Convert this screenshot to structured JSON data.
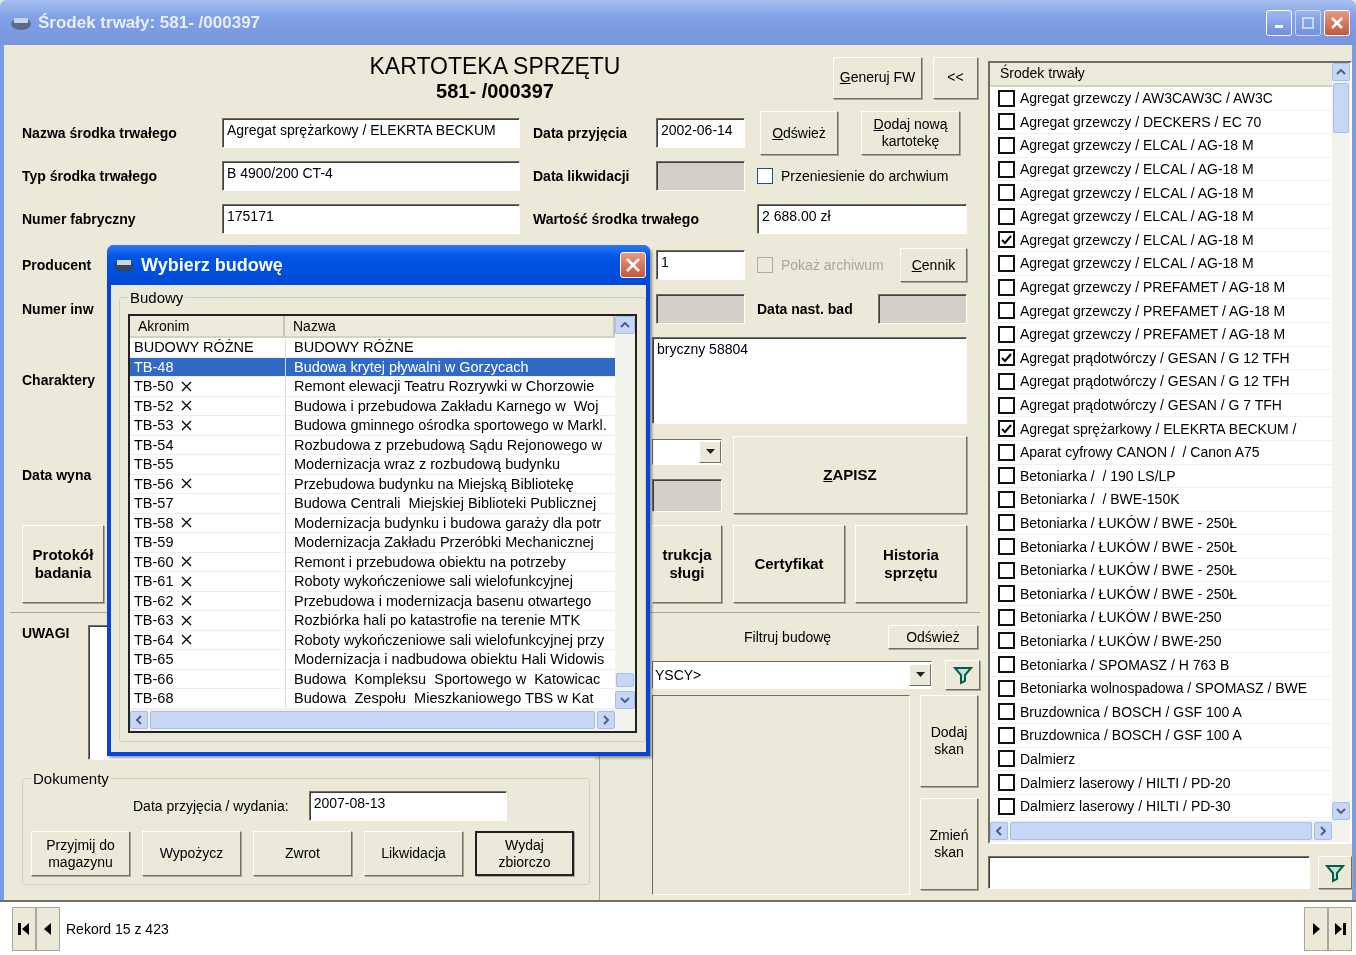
{
  "window": {
    "title": "Środek trwały: 581- /000397"
  },
  "header": {
    "title": "KARTOTEKA SPRZĘTU",
    "number": "581- /000397",
    "buttons": [
      {
        "label": "Generuj FW",
        "mnemonic": true
      },
      {
        "label": "<<",
        "mnemonic": false
      }
    ]
  },
  "form": {
    "name": {
      "label": "Nazwa środka trwałego",
      "value": "Agregat sprężarkowy / ELEKRTA BECKUM"
    },
    "type": {
      "label": "Typ środka trwałego",
      "value": "B 4900/200 CT-4"
    },
    "serial": {
      "label": "Numer fabryczny",
      "value": "175171"
    },
    "producer": {
      "label": "Producent"
    },
    "inventory": {
      "label": "Numer inw"
    },
    "description": {
      "label": "Charaktery",
      "value": "bryczny 58804"
    },
    "issue_date": {
      "label": "Data wyna"
    },
    "received": {
      "label": "Data przyjęcia",
      "value": "2002-06-14"
    },
    "liquidation": {
      "label": "Data likwidacji",
      "disabled": true
    },
    "asset_value": {
      "label": "Wartość środka trwałego",
      "value": "2 688.00 zł"
    },
    "quantity": {
      "value": "1"
    },
    "field_under_quantity": {
      "disabled": true
    },
    "field_under_combo": {
      "disabled": true
    },
    "next_test": {
      "label": "Data nast. bad",
      "disabled": true
    },
    "archive_move": {
      "label": "Przeniesienie do archwium",
      "checked": false,
      "disabled": false
    },
    "show_archive": {
      "label": "Pokaż archiwum",
      "checked": false,
      "disabled": true
    }
  },
  "buttons": {
    "refresh": {
      "label": "Odśwież",
      "mnemonic": true
    },
    "add": {
      "label": "Dodaj nową\nkartotekę",
      "mnemonic": true
    },
    "price": {
      "label": "Cennik",
      "mnemonic": true
    },
    "save": {
      "label": "ZAPISZ",
      "mnemonic": true
    },
    "protocol": {
      "label": "Protokół\nbadania",
      "mnemonic": false
    },
    "manual": {
      "label": "trukcja\nsługi",
      "mnemonic": false
    },
    "certificate": {
      "label": "Certyfikat",
      "mnemonic": false
    },
    "history": {
      "label": "Historia\nsprzętu",
      "mnemonic": false
    }
  },
  "notes": {
    "label": "UWAGI"
  },
  "documents": {
    "title": "Dokumenty",
    "date_label": "Data przyjęcia / wydania:",
    "date_value": "2007-08-13",
    "buttons": [
      {
        "label": "Przyjmij do\nmagazynu",
        "default": false
      },
      {
        "label": "Wypożycz",
        "default": false
      },
      {
        "label": "Zwrot",
        "default": false
      },
      {
        "label": "Likwidacja",
        "default": false
      },
      {
        "label": "Wydaj\nzbiorczo",
        "default": true
      }
    ]
  },
  "site_filter": {
    "label": "Filtruj budowę",
    "refresh": {
      "label": "Odśwież",
      "mnemonic": false
    },
    "value": "YSCY>",
    "scan_buttons": [
      {
        "label": "Dodaj\nskan",
        "mnemonic": false
      },
      {
        "label": "Zmień\nskan",
        "mnemonic": false
      }
    ]
  },
  "assets": {
    "header": "Środek trwały",
    "items": [
      {
        "label": "Agregat grzewczy / AW3CAW3C / AW3C",
        "checked": false
      },
      {
        "label": "Agregat grzewczy / DECKERS / EC 70",
        "checked": false
      },
      {
        "label": "Agregat grzewczy / ELCAL / AG-18 M",
        "checked": false
      },
      {
        "label": "Agregat grzewczy / ELCAL / AG-18 M",
        "checked": false
      },
      {
        "label": "Agregat grzewczy / ELCAL / AG-18 M",
        "checked": false
      },
      {
        "label": "Agregat grzewczy / ELCAL / AG-18 M",
        "checked": false
      },
      {
        "label": "Agregat grzewczy / ELCAL / AG-18 M",
        "checked": true
      },
      {
        "label": "Agregat grzewczy / ELCAL / AG-18 M",
        "checked": false
      },
      {
        "label": "Agregat grzewczy / PREFAMET / AG-18 M",
        "checked": false
      },
      {
        "label": "Agregat grzewczy / PREFAMET / AG-18 M",
        "checked": false
      },
      {
        "label": "Agregat grzewczy / PREFAMET / AG-18 M",
        "checked": false
      },
      {
        "label": "Agregat prądotwórczy / GESAN / G 12 TFH",
        "checked": true
      },
      {
        "label": "Agregat prądotwórczy / GESAN / G 12 TFH",
        "checked": false
      },
      {
        "label": "Agregat prądotwórczy / GESAN / G 7 TFH",
        "checked": false
      },
      {
        "label": "Agregat sprężarkowy / ELEKRTA BECKUM /",
        "checked": true
      },
      {
        "label": "Aparat cyfrowy CANON /  / Canon A75",
        "checked": false
      },
      {
        "label": "Betoniarka /  / 190 LS/LP",
        "checked": false
      },
      {
        "label": "Betoniarka /  / BWE-150K",
        "checked": false
      },
      {
        "label": "Betoniarka / ŁUKÓW / BWE - 250Ł",
        "checked": false
      },
      {
        "label": "Betoniarka / ŁUKÓW / BWE - 250Ł",
        "checked": false
      },
      {
        "label": "Betoniarka / ŁUKÓW / BWE - 250Ł",
        "checked": false
      },
      {
        "label": "Betoniarka / ŁUKÓW / BWE - 250Ł",
        "checked": false
      },
      {
        "label": "Betoniarka / ŁUKÓW / BWE-250",
        "checked": false
      },
      {
        "label": "Betoniarka / ŁUKÓW / BWE-250",
        "checked": false
      },
      {
        "label": "Betoniarka / SPOMASZ / H 763 B",
        "checked": false
      },
      {
        "label": "Betoniarka wolnospadowa / SPOMASZ / BWE",
        "checked": false
      },
      {
        "label": "Bruzdownica / BOSCH / GSF 100 A",
        "checked": false
      },
      {
        "label": "Bruzdownica / BOSCH / GSF 100 A",
        "checked": false
      },
      {
        "label": "Dalmierz",
        "checked": false
      },
      {
        "label": "Dalmierz laserowy / HILTI / PD-20",
        "checked": false
      },
      {
        "label": "Dalmierz laserowy / HILTI / PD-30",
        "checked": false
      }
    ]
  },
  "record": {
    "text": "Rekord 15 z 423"
  },
  "dialog": {
    "title": "Wybierz budowę",
    "group": "Budowy",
    "columns": [
      "Akronim",
      "Nazwa"
    ],
    "rows": [
      {
        "acronym": "BUDOWY RÓŻNE",
        "name": "BUDOWY RÓŻNE",
        "crossed": false,
        "selected": false
      },
      {
        "acronym": "TB-48",
        "name": "Budowa krytej pływalni w Gorzycach",
        "crossed": false,
        "selected": true
      },
      {
        "acronym": "TB-50",
        "name": "Remont elewacji Teatru Rozrywki w Chorzowie",
        "crossed": true,
        "selected": false
      },
      {
        "acronym": "TB-52",
        "name": "Budowa i przebudowa Zakładu Karnego w  Woj",
        "crossed": true,
        "selected": false
      },
      {
        "acronym": "TB-53",
        "name": "Budowa gminnego ośrodka sportowego w Markl.",
        "crossed": true,
        "selected": false
      },
      {
        "acronym": "TB-54",
        "name": "Rozbudowa z przebudową Sądu Rejonowego w",
        "crossed": false,
        "selected": false
      },
      {
        "acronym": "TB-55",
        "name": "Modernizacja wraz z rozbudową budynku",
        "crossed": false,
        "selected": false
      },
      {
        "acronym": "TB-56",
        "name": "Przebudowa budynku na Miejską Bibliotekę",
        "crossed": true,
        "selected": false
      },
      {
        "acronym": "TB-57",
        "name": "Budowa Centrali  Miejskiej Biblioteki Publicznej",
        "crossed": false,
        "selected": false
      },
      {
        "acronym": "TB-58",
        "name": "Modernizacja budynku i budowa garaży dla potr",
        "crossed": true,
        "selected": false
      },
      {
        "acronym": "TB-59",
        "name": "Modernizacja Zakładu Przeróbki Mechanicznej",
        "crossed": false,
        "selected": false
      },
      {
        "acronym": "TB-60",
        "name": "Remont i przebudowa obiektu na potrzeby",
        "crossed": true,
        "selected": false
      },
      {
        "acronym": "TB-61",
        "name": "Roboty wykończeniowe sali wielofunkcyjnej",
        "crossed": true,
        "selected": false
      },
      {
        "acronym": "TB-62",
        "name": "Przebudowa i modernizacja basenu otwartego",
        "crossed": true,
        "selected": false
      },
      {
        "acronym": "TB-63",
        "name": "Rozbiórka hali po katastrofie na terenie MTK",
        "crossed": true,
        "selected": false
      },
      {
        "acronym": "TB-64",
        "name": "Roboty wykończeniowe sali wielofunkcyjnej przy",
        "crossed": true,
        "selected": false
      },
      {
        "acronym": "TB-65",
        "name": "Modernizacja i nadbudowa obiektu Hali Widowis",
        "crossed": false,
        "selected": false
      },
      {
        "acronym": "TB-66",
        "name": "Budowa  Kompleksu  Sportowego w  Katowicac",
        "crossed": false,
        "selected": false
      },
      {
        "acronym": "TB-68",
        "name": "Budowa  Zespołu  Mieszkaniowego TBS w Kat",
        "crossed": false,
        "selected": false
      }
    ]
  }
}
